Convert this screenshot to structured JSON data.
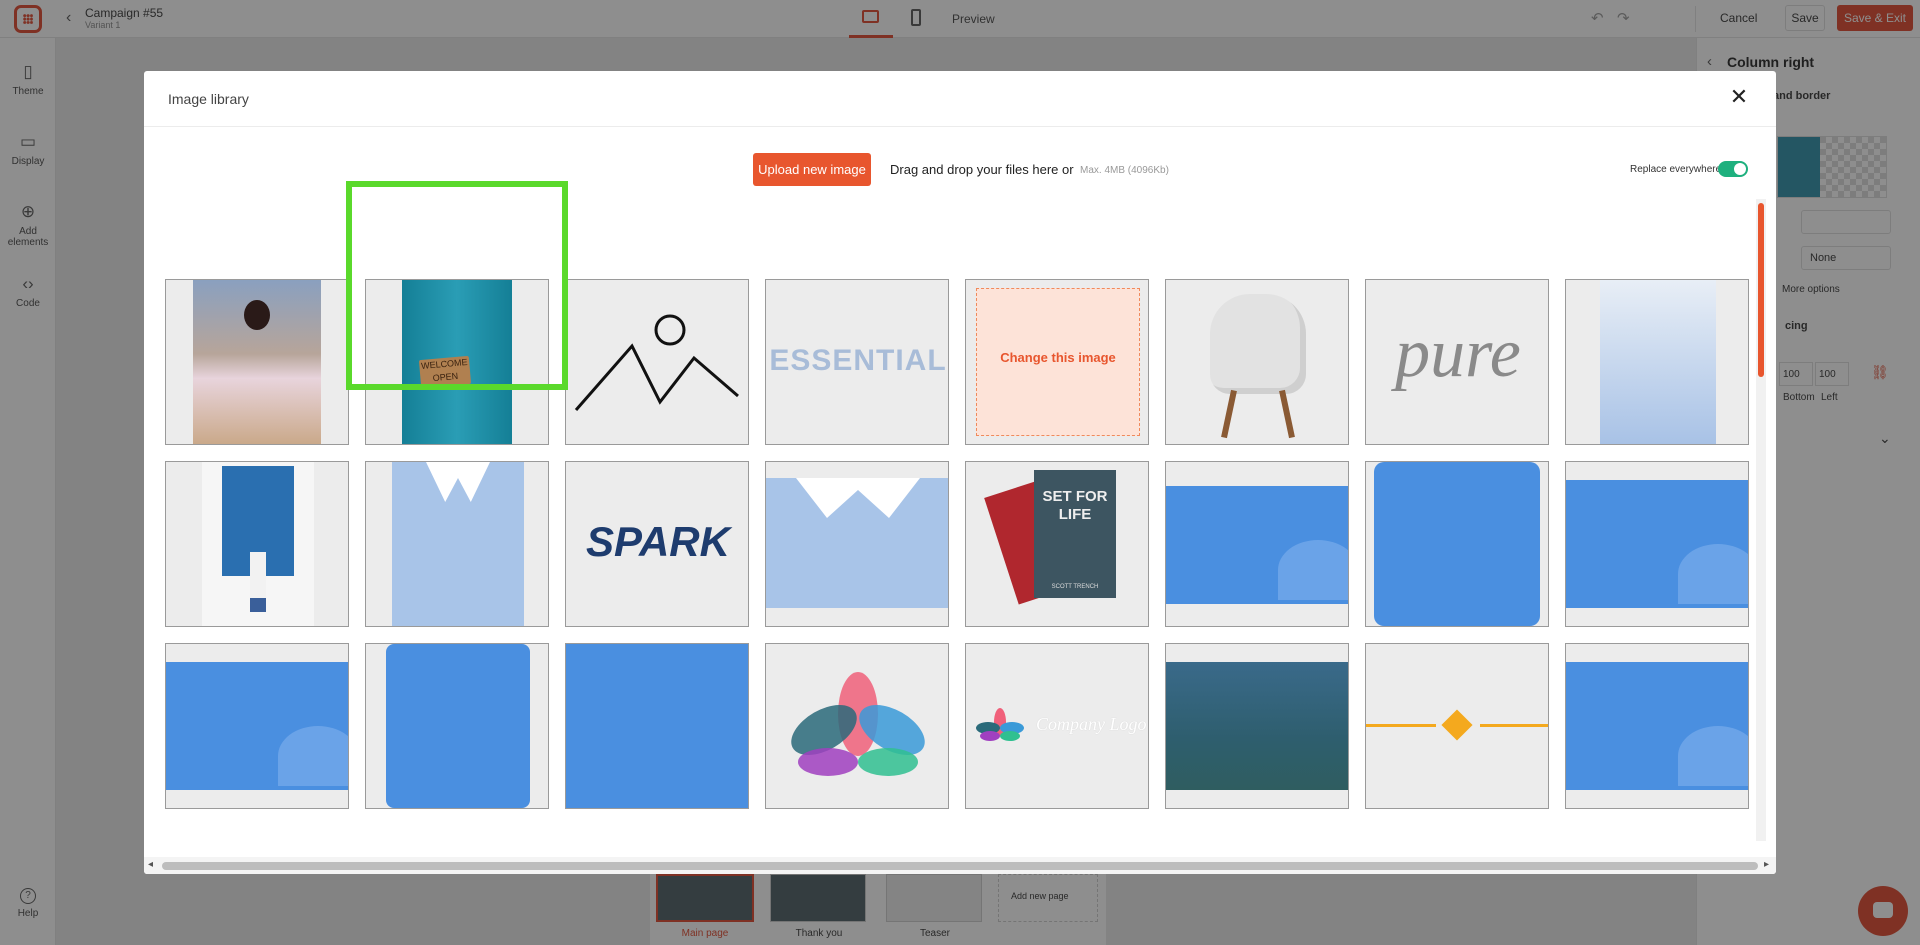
{
  "topbar": {
    "campaign_title": "Campaign #55",
    "variant": "Variant 1",
    "preview_label": "Preview",
    "cancel_label": "Cancel",
    "save_label": "Save",
    "save_exit_label": "Save & Exit"
  },
  "sidebar": {
    "items": [
      {
        "label": "Theme",
        "icon": "brush-icon"
      },
      {
        "label": "Display",
        "icon": "monitor-icon"
      },
      {
        "label": "Add elements",
        "icon": "plus-circle-icon"
      },
      {
        "label": "Code",
        "icon": "code-icon"
      }
    ],
    "help_label": "Help"
  },
  "right_panel": {
    "title": "Column right",
    "section_background": "and border",
    "select_value": "None",
    "more_options": "More options",
    "section_spacing": "cing",
    "num_value_1": "100",
    "num_value_2": "100",
    "label_bottom": "Bottom",
    "label_left": "Left"
  },
  "page_tabs": {
    "main": "Main page",
    "thanks": "Thank you",
    "teaser": "Teaser",
    "add": "Add new page"
  },
  "modal": {
    "title": "Image library",
    "upload_label": "Upload new image",
    "drag_text": "Drag and drop your files here or",
    "max_size": "Max. 4MB (4096Kb)",
    "replace_label": "Replace everywhere",
    "replace_enabled": true,
    "selected_index": 1,
    "tile_texts": {
      "essential": "ESSENTIAL",
      "change": "Change this image",
      "pure": "pure",
      "spark": "SPARK",
      "book_title": "SET FOR LIFE",
      "book_author": "SCOTT TRENCH",
      "company_logo": "Company Logo"
    }
  },
  "colors": {
    "brand": "#e0452a",
    "highlight": "#5ad92b",
    "toggle_on": "#1eb07e",
    "placeholder_blue": "#4a8fe0"
  }
}
